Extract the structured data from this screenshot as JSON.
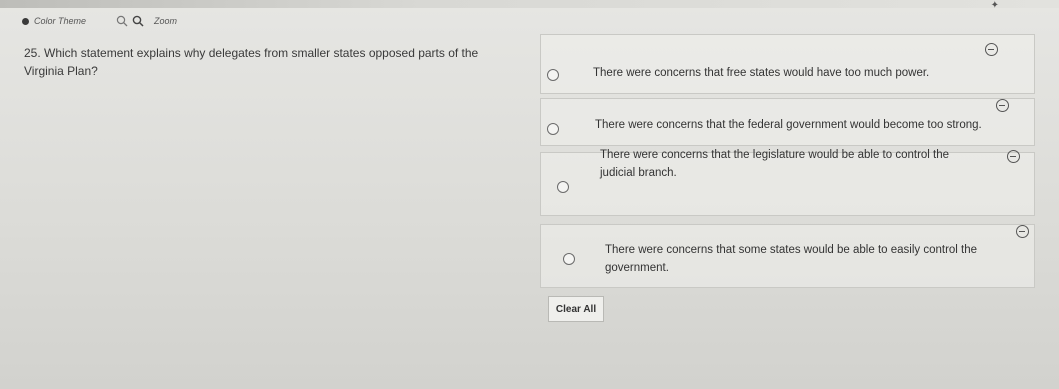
{
  "toolbar": {
    "color_theme_label": "Color Theme",
    "zoom_label": "Zoom"
  },
  "question": {
    "text": "25. Which statement explains why delegates from smaller states opposed parts of the Virginia Plan?"
  },
  "choices": [
    {
      "text": "There were concerns that free states would have too much power."
    },
    {
      "text": "There were concerns that the federal government would become too strong."
    },
    {
      "text": "There were concerns that the legislature would be able to control the judicial branch."
    },
    {
      "text": "There were concerns that some states would be able to easily control the government."
    }
  ],
  "actions": {
    "clear_all_label": "Clear All"
  }
}
